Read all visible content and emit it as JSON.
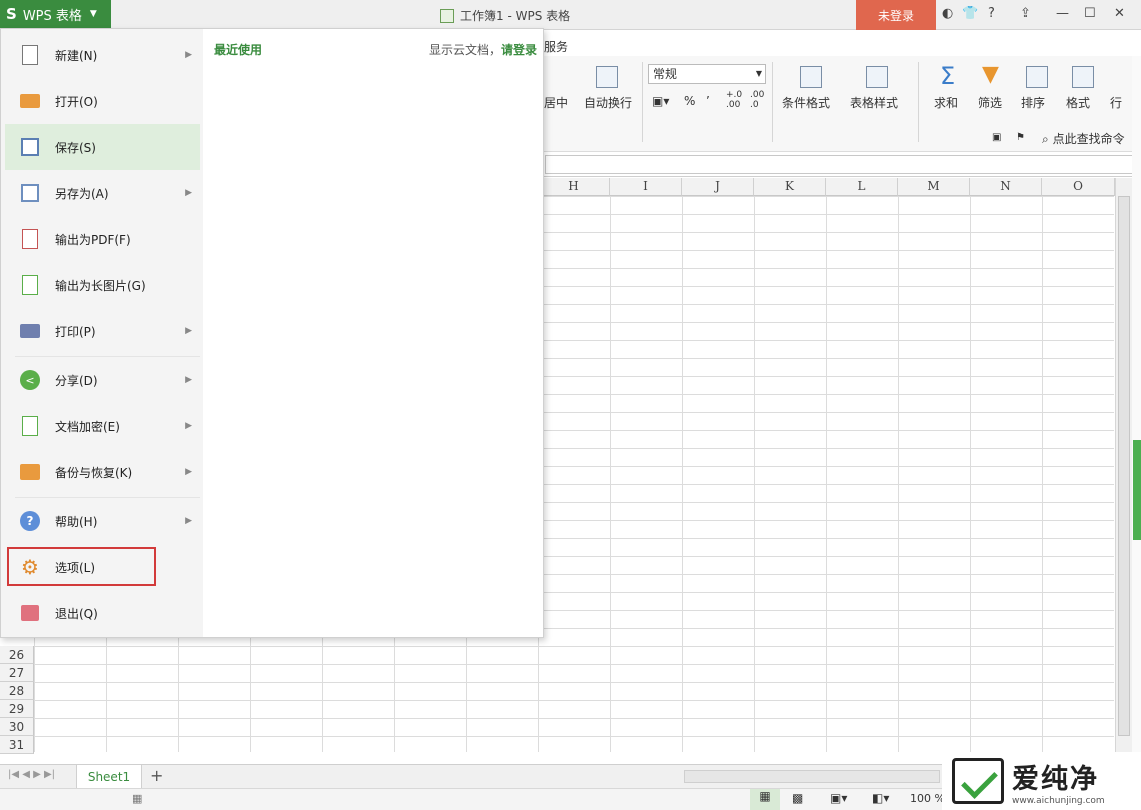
{
  "app": {
    "menu_button_logo": "S",
    "menu_button_label": "WPS 表格",
    "title": "工作簿1 - WPS 表格",
    "login_button": "未登录"
  },
  "ribbon": {
    "visible_tab": "服务",
    "items": {
      "merge_center": "居中",
      "wrap_text": "自动换行",
      "number_format": "常规",
      "percent": "%",
      "comma": "’",
      "conditional_format": "条件格式",
      "table_style": "表格样式",
      "sum": "求和",
      "filter": "筛选",
      "sort": "排序",
      "format": "格式",
      "rowcol": "行"
    },
    "search_command": "点此查找命令"
  },
  "grid": {
    "columns": [
      "H",
      "I",
      "J",
      "K",
      "L",
      "M",
      "N",
      "O"
    ],
    "rows": [
      "26",
      "27",
      "28",
      "29",
      "30",
      "31"
    ]
  },
  "sheet_tabs": [
    "Sheet1"
  ],
  "add_sheet": "+",
  "status": {
    "zoom": "100 %"
  },
  "file_menu": {
    "items": [
      {
        "label": "新建(N)",
        "icon": "new-document-icon",
        "submenu": true
      },
      {
        "label": "打开(O)",
        "icon": "open-folder-icon",
        "submenu": false
      },
      {
        "label": "保存(S)",
        "icon": "save-icon",
        "submenu": false
      },
      {
        "label": "另存为(A)",
        "icon": "save-as-icon",
        "submenu": true
      },
      {
        "label": "输出为PDF(F)",
        "icon": "export-pdf-icon",
        "submenu": false
      },
      {
        "label": "输出为长图片(G)",
        "icon": "export-image-icon",
        "submenu": false
      },
      {
        "label": "打印(P)",
        "icon": "printer-icon",
        "submenu": true
      },
      {
        "label": "分享(D)",
        "icon": "share-icon",
        "submenu": true
      },
      {
        "label": "文档加密(E)",
        "icon": "encrypt-document-icon",
        "submenu": true
      },
      {
        "label": "备份与恢复(K)",
        "icon": "backup-icon",
        "submenu": true
      },
      {
        "label": "帮助(H)",
        "icon": "help-icon",
        "submenu": true
      },
      {
        "label": "选项(L)",
        "icon": "gear-icon",
        "submenu": false
      },
      {
        "label": "退出(Q)",
        "icon": "exit-icon",
        "submenu": false
      }
    ],
    "recent_title": "最近使用",
    "cloud_text": "显示云文档，",
    "cloud_link": "请登录"
  },
  "watermark": {
    "name": "爱纯净",
    "url": "www.aichunjing.com"
  },
  "colors": {
    "brand_green": "#3a8c3f",
    "login_red": "#e0674e",
    "highlight_red": "#d23a3a"
  }
}
